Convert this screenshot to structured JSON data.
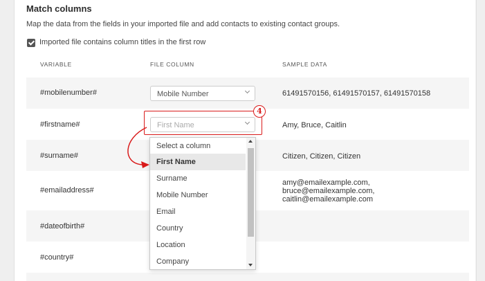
{
  "section": {
    "title": "Match columns",
    "description": "Map the data from the fields in your imported file and add contacts to existing contact groups.",
    "header_checkbox": {
      "label": "Imported file contains column titles in the first row",
      "checked": true
    }
  },
  "table": {
    "headers": [
      "VARIABLE",
      "FILE COLUMN",
      "SAMPLE DATA"
    ],
    "rows": [
      {
        "variable": "#mobilenumber#",
        "file_column": "Mobile Number",
        "sample": [
          "61491570156, 61491570157, 61491570158"
        ]
      },
      {
        "variable": "#firstname#",
        "file_column": "First Name",
        "sample": [
          "Amy, Bruce, Caitlin"
        ]
      },
      {
        "variable": "#surname#",
        "file_column": "",
        "sample": [
          "Citizen, Citizen, Citizen"
        ]
      },
      {
        "variable": "#emailaddress#",
        "file_column": "",
        "sample": [
          "amy@emailexample.com,",
          "bruce@emailexample.com,",
          "caitlin@emailexample.com"
        ]
      },
      {
        "variable": "#dateofbirth#",
        "file_column": "",
        "sample": []
      },
      {
        "variable": "#country#",
        "file_column": "",
        "sample": []
      }
    ]
  },
  "dropdown": {
    "options": [
      "Select a column",
      "First Name",
      "Surname",
      "Mobile Number",
      "Email",
      "Country",
      "Location",
      "Company"
    ],
    "selected": "First Name"
  },
  "callout": {
    "number": "4",
    "color": "#d91a1a"
  },
  "icons": {
    "checkbox": "checkmark-icon",
    "select": "chevron-down-icon",
    "scroll_up": "arrow-up-icon",
    "scroll_down": "arrow-down-icon"
  }
}
